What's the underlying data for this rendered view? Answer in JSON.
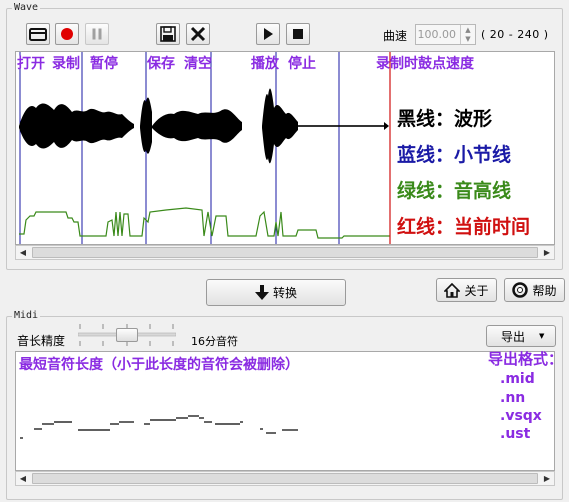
{
  "wave": {
    "group_title": "Wave",
    "toolbar": {
      "open_icon": "folder-open-icon",
      "record_icon": "record-icon",
      "pause_icon": "pause-icon",
      "save_icon": "floppy-disk-icon",
      "clear_icon": "close-x-icon",
      "play_icon": "play-icon",
      "stop_icon": "stop-icon"
    },
    "tempo_label": "曲速",
    "tempo_value": "100.00",
    "tempo_range": "( 20 - 240 )",
    "annotations": {
      "open": "打开",
      "record": "录制",
      "pause": "暂停",
      "save": "保存",
      "clear": "清空",
      "play": "播放",
      "stop": "停止",
      "record_tempo": "录制时鼓点速度"
    },
    "legend": {
      "black": "黑线：波形",
      "blue": "蓝线：小节线",
      "green": "绿线：音高线",
      "red": "红线：当前时间"
    },
    "colors": {
      "black": "#000000",
      "blue": "#1a1aa6",
      "green": "#3a8a1a",
      "red": "#d01010"
    }
  },
  "convert_button": {
    "label": "转换",
    "icon": "down-arrow-icon"
  },
  "about_button": {
    "label": "关于",
    "icon": "home-icon"
  },
  "help_button": {
    "label": "帮助",
    "icon": "lifebuoy-icon"
  },
  "midi": {
    "group_title": "Midi",
    "precision_label": "音长精度",
    "precision_value": "16分音符",
    "export_label": "导出",
    "note_annotation": "最短音符长度（小于此长度的音符会被删除）",
    "export_formats_title": "导出格式：",
    "export_formats": [
      ".mid",
      ".nn",
      ".vsqx",
      ".ust"
    ],
    "slider_position": 0.5
  }
}
